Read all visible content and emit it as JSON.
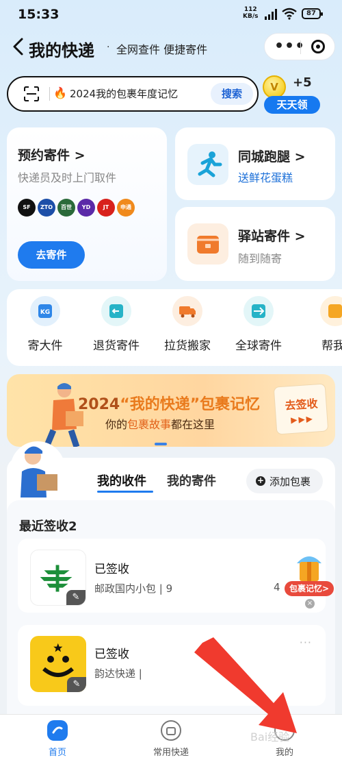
{
  "status_bar": {
    "time": "15:33",
    "net_speed": "112",
    "net_unit": "KB/s",
    "battery": "87"
  },
  "header": {
    "title": "我的快递",
    "separator": "·",
    "subtitle": "全网查件 便捷寄件"
  },
  "search": {
    "text": "2024我的包裹年度记忆",
    "button": "搜索"
  },
  "reward": {
    "coin": "V",
    "amount": "+5",
    "label": "天天领"
  },
  "cards": {
    "send": {
      "title": "预约寄件 >",
      "subtitle": "快递员及时上门取件",
      "button": "去寄件",
      "carriers": [
        "SF",
        "ZTO",
        "百世",
        "YD",
        "JT",
        "申通"
      ]
    },
    "runner": {
      "title": "同城跑腿 >",
      "subtitle": "送鲜花蛋糕"
    },
    "station": {
      "title": "驿站寄件 >",
      "subtitle": "随到随寄"
    }
  },
  "quick_grid": [
    {
      "label": "寄大件",
      "icon": "kg-icon"
    },
    {
      "label": "退货寄件",
      "icon": "return-icon"
    },
    {
      "label": "拉货搬家",
      "icon": "truck-icon"
    },
    {
      "label": "全球寄件",
      "icon": "plane-icon"
    },
    {
      "label": "帮我",
      "icon": "help-icon"
    }
  ],
  "banner": {
    "year": "2024",
    "title": "“我的快递”包裹记忆",
    "subtitle_a": "你的",
    "subtitle_em1": "包裹故事",
    "subtitle_b": "都在这里",
    "button": "去签收",
    "arrows": "▶▶▶"
  },
  "tabs": {
    "received": "我的收件",
    "sent": "我的寄件",
    "add": "添加包裹"
  },
  "recent": {
    "heading": "最近签收2"
  },
  "packages": [
    {
      "status": "已签收",
      "desc": "邮政国内小包 | 9",
      "tail": "4",
      "carrier": "china-post"
    },
    {
      "status": "已签收",
      "desc": "韵达快递 |",
      "tail": "",
      "carrier": "yunda"
    }
  ],
  "memo_float": {
    "label": "包裹记忆>"
  },
  "more": "···",
  "nav": [
    {
      "label": "首页"
    },
    {
      "label": "常用快递"
    },
    {
      "label": "我的"
    }
  ],
  "watermark": "Bai经验"
}
